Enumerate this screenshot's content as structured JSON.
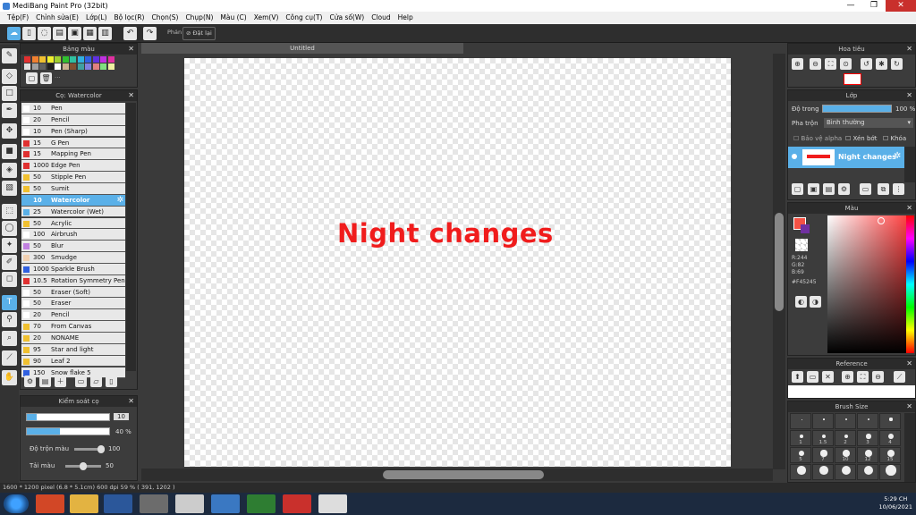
{
  "window": {
    "title": "MediBang Paint Pro (32bit)",
    "min": "—",
    "max": "❐",
    "close": "✕"
  },
  "menu": [
    "Tệp(F)",
    "Chỉnh sửa(E)",
    "Lớp(L)",
    "Bộ lọc(R)",
    "Chọn(S)",
    "Chụp(N)",
    "Màu (C)",
    "Xem(V)",
    "Công cụ(T)",
    "Cửa số(W)",
    "Cloud",
    "Help"
  ],
  "toolbar": {
    "prefix": "Phản",
    "reset": "Đặt lại"
  },
  "palette": {
    "title": "Bảng màu",
    "colors": [
      "#e03030",
      "#f08030",
      "#f0c030",
      "#f0f030",
      "#a0d030",
      "#30c030",
      "#30c0a0",
      "#30b0e0",
      "#3060e0",
      "#6030e0",
      "#c030e0",
      "#e030a0",
      "#e0e0e0",
      "#a0a0a0",
      "#606060",
      "#202020",
      "#ffffff",
      "#c8b090",
      "#805030",
      "#40a0a0",
      "#8080e0",
      "#e08080",
      "#80e080",
      "#f0f0a0"
    ]
  },
  "brushes": {
    "title": "Cọ: Watercolor",
    "items": [
      {
        "size": "10",
        "name": "Pen",
        "color": "#ffffff"
      },
      {
        "size": "20",
        "name": "Pencil",
        "color": "#ffffff"
      },
      {
        "size": "10",
        "name": "Pen (Sharp)",
        "color": "#ffffff"
      },
      {
        "size": "15",
        "name": "G Pen",
        "color": "#e03030"
      },
      {
        "size": "15",
        "name": "Mapping Pen",
        "color": "#e03030"
      },
      {
        "size": "1000",
        "name": "Edge Pen",
        "color": "#e03030"
      },
      {
        "size": "50",
        "name": "Stipple Pen",
        "color": "#f0c030"
      },
      {
        "size": "50",
        "name": "Sumit",
        "color": "#f0c030"
      },
      {
        "size": "10",
        "name": "Watercolor",
        "color": "#5ab0e8"
      },
      {
        "size": "25",
        "name": "Watercolor (Wet)",
        "color": "#5ab0e8"
      },
      {
        "size": "50",
        "name": "Acrylic",
        "color": "#f0c030"
      },
      {
        "size": "100",
        "name": "Airbrush",
        "color": "#ffffff"
      },
      {
        "size": "50",
        "name": "Blur",
        "color": "#c080e0"
      },
      {
        "size": "300",
        "name": "Smudge",
        "color": "#f0d0b0"
      },
      {
        "size": "1000",
        "name": "Sparkle Brush",
        "color": "#3060e0"
      },
      {
        "size": "10.5",
        "name": "Rotation Symmetry Pen",
        "color": "#e03030"
      },
      {
        "size": "50",
        "name": "Eraser (Soft)",
        "color": "#ffffff"
      },
      {
        "size": "50",
        "name": "Eraser",
        "color": "#ffffff"
      },
      {
        "size": "20",
        "name": "Pencil",
        "color": "#ffffff"
      },
      {
        "size": "70",
        "name": "From Canvas",
        "color": "#f0c030"
      },
      {
        "size": "20",
        "name": "NONAME",
        "color": "#f0c030"
      },
      {
        "size": "95",
        "name": "Star and light",
        "color": "#f0c030"
      },
      {
        "size": "90",
        "name": "Leaf 2",
        "color": "#f0c030"
      },
      {
        "size": "150",
        "name": "Snow flake 5",
        "color": "#3060e0"
      }
    ]
  },
  "brush_control": {
    "title": "Kiểm soát cọ",
    "size_value": "10",
    "opacity_value": "40 %",
    "mix_label": "Độ trộn màu",
    "mix_value": "100",
    "refill_label": "Tải màu",
    "refill_value": "50",
    "size_level": 0.12,
    "opacity_level": 0.4,
    "mix_level": 1.0,
    "refill_level": 0.5
  },
  "canvas": {
    "tab": "Untitled",
    "text": "Night changes",
    "text_color": "#f01c1c"
  },
  "navigator": {
    "title": "Hoa tiêu"
  },
  "layers": {
    "title": "Lớp",
    "opacity_label": "Độ trong",
    "opacity_value": "100 %",
    "opacity_level": 1.0,
    "blend_label": "Pha trộn",
    "blend_value": "Bình thường",
    "protect_alpha": "Bảo vệ alpha",
    "clipping": "Xén bớt",
    "lock": "Khóa",
    "layer_name": "Night changes"
  },
  "color": {
    "title": "Màu",
    "r": "R:244",
    "g": "G:82",
    "b": "B:69",
    "hex": "#F45245",
    "current": "#f45245"
  },
  "reference": {
    "title": "Reference"
  },
  "brush_size": {
    "title": "Brush Size",
    "labels": [
      "1",
      "1.5",
      "2",
      "3",
      "4",
      "5",
      "7",
      "10",
      "12",
      "15"
    ]
  },
  "status": {
    "text": "1600 * 1200 pixel  (6.8 * 5.1cm)  600 dpi  59 %  ( 391, 1202 )"
  },
  "taskbar": {
    "time": "5:29 CH",
    "date": "10/06/2021"
  }
}
